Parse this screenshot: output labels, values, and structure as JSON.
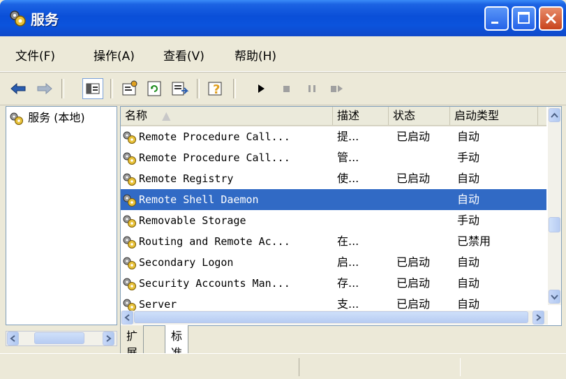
{
  "window": {
    "title": "服务"
  },
  "menubar": {
    "items": [
      {
        "label": "文件(F)"
      },
      {
        "label": "操作(A)"
      },
      {
        "label": "查看(V)"
      },
      {
        "label": "帮助(H)"
      }
    ]
  },
  "toolbar": {
    "icons": [
      "back-icon",
      "forward-icon",
      "show-hide-tree-icon",
      "properties-icon",
      "refresh-icon",
      "export-list-icon",
      "help-icon",
      "start-icon",
      "stop-icon",
      "pause-icon",
      "restart-icon"
    ]
  },
  "tree": {
    "root_label": "服务 (本地)"
  },
  "list": {
    "columns": [
      "名称",
      "描述",
      "状态",
      "启动类型"
    ],
    "rows": [
      {
        "name": "Remote Procedure Call...",
        "desc": "提...",
        "status": "已启动",
        "startup": "自动",
        "selected": false
      },
      {
        "name": "Remote Procedure Call...",
        "desc": "管...",
        "status": "",
        "startup": "手动",
        "selected": false
      },
      {
        "name": "Remote Registry",
        "desc": "使...",
        "status": "已启动",
        "startup": "自动",
        "selected": false
      },
      {
        "name": "Remote Shell Daemon",
        "desc": "",
        "status": "",
        "startup": "自动",
        "selected": true
      },
      {
        "name": "Removable Storage",
        "desc": "",
        "status": "",
        "startup": "手动",
        "selected": false
      },
      {
        "name": "Routing and Remote Ac...",
        "desc": "在...",
        "status": "",
        "startup": "已禁用",
        "selected": false
      },
      {
        "name": "Secondary Logon",
        "desc": "启...",
        "status": "已启动",
        "startup": "自动",
        "selected": false
      },
      {
        "name": "Security Accounts Man...",
        "desc": "存...",
        "status": "已启动",
        "startup": "自动",
        "selected": false
      },
      {
        "name": "Server",
        "desc": "支...",
        "status": "已启动",
        "startup": "自动",
        "selected": false
      }
    ]
  },
  "tabs": [
    {
      "label": "扩展"
    },
    {
      "label": "标准"
    }
  ],
  "colors": {
    "selection": "#316AC5",
    "titlebar": "#0A4FD8"
  }
}
